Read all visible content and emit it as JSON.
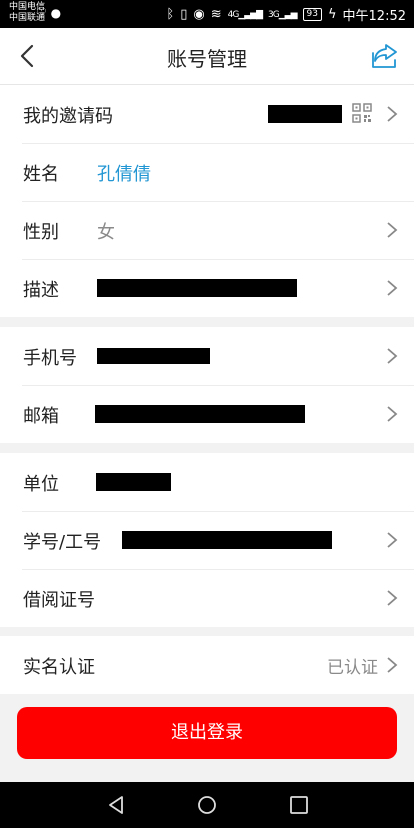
{
  "status_bar": {
    "carrier_1": "中国电信",
    "carrier_2": "中国联通",
    "network_tag": "4G",
    "network_tag_2": "3G",
    "battery": "93",
    "time": "中午12:52"
  },
  "header": {
    "title": "账号管理"
  },
  "sections": {
    "s1": {
      "invite_code": {
        "label": "我的邀请码"
      },
      "name": {
        "label": "姓名",
        "value": "孔倩倩"
      },
      "gender": {
        "label": "性别",
        "value": "女"
      },
      "description": {
        "label": "描述"
      }
    },
    "s2": {
      "phone": {
        "label": "手机号"
      },
      "email": {
        "label": "邮箱"
      }
    },
    "s3": {
      "unit": {
        "label": "单位"
      },
      "student_id": {
        "label": "学号/工号"
      },
      "library_card": {
        "label": "借阅证号"
      }
    },
    "s4": {
      "real_name": {
        "label": "实名认证",
        "status": "已认证"
      }
    }
  },
  "logout_button": {
    "label": "退出登录"
  },
  "colors": {
    "accent_blue": "#2196d3",
    "logout_red": "#ff0000",
    "redaction": "#000000"
  },
  "icons": [
    "back-arrow-icon",
    "share-icon",
    "qr-code-icon",
    "chevron-right-icon",
    "nav-back-icon",
    "nav-home-icon",
    "nav-recents-icon"
  ]
}
